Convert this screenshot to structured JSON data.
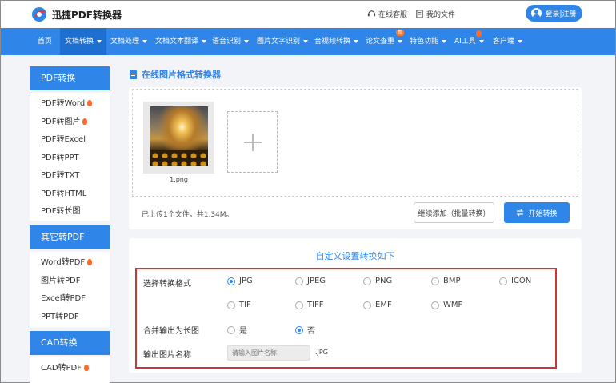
{
  "header": {
    "brand": "迅捷PDF转换器",
    "service_label": "在线客服",
    "files_label": "我的文件",
    "login_label": "登录|注册",
    "brand_colors": [
      "#2f86e8",
      "#e53935"
    ]
  },
  "nav": {
    "items": [
      {
        "label": "首页"
      },
      {
        "label": "文档转换"
      },
      {
        "label": "文档处理"
      },
      {
        "label": "文档文本翻译"
      },
      {
        "label": "语音识别"
      },
      {
        "label": "图片文字识别"
      },
      {
        "label": "音视频转换"
      },
      {
        "label": "论文查重"
      },
      {
        "label": "特色功能"
      },
      {
        "label": "AI工具"
      },
      {
        "label": "客户端"
      }
    ],
    "new_badge": "新"
  },
  "sidebar": {
    "sections": [
      {
        "title": "PDF转换",
        "items": [
          {
            "label": "PDF转Word",
            "hot": true
          },
          {
            "label": "PDF转图片",
            "hot": true
          },
          {
            "label": "PDF转Excel",
            "hot": false
          },
          {
            "label": "PDF转PPT",
            "hot": false
          },
          {
            "label": "PDF转TXT",
            "hot": false
          },
          {
            "label": "PDF转HTML",
            "hot": false
          },
          {
            "label": "PDF转长图",
            "hot": false
          }
        ]
      },
      {
        "title": "其它转PDF",
        "items": [
          {
            "label": "Word转PDF",
            "hot": true
          },
          {
            "label": "图片转PDF",
            "hot": false
          },
          {
            "label": "Excel转PDF",
            "hot": false
          },
          {
            "label": "PPT转PDF",
            "hot": false
          }
        ]
      },
      {
        "title": "CAD转换",
        "items": [
          {
            "label": "CAD转PDF",
            "hot": true
          }
        ]
      }
    ]
  },
  "main": {
    "page_title": "在线图片格式转换器",
    "upload": {
      "file_name": "1.png",
      "status": "已上传1个文件，共1.34M。",
      "continue_label": "继续添加（批量转换）",
      "start_label": "开始转换"
    },
    "settings": {
      "title": "自定义设置转换如下",
      "format_label": "选择转换格式",
      "formats": [
        "JPG",
        "JPEG",
        "PNG",
        "BMP",
        "ICON",
        "TIF",
        "TIFF",
        "EMF",
        "WMF"
      ],
      "selected_format": "JPG",
      "merge_label": "合并输出为长图",
      "merge_options": [
        "是",
        "否"
      ],
      "merge_selected": "否",
      "name_label": "输出图片名称",
      "name_placeholder": "请输入图片名称",
      "extension": ".JPG"
    }
  }
}
